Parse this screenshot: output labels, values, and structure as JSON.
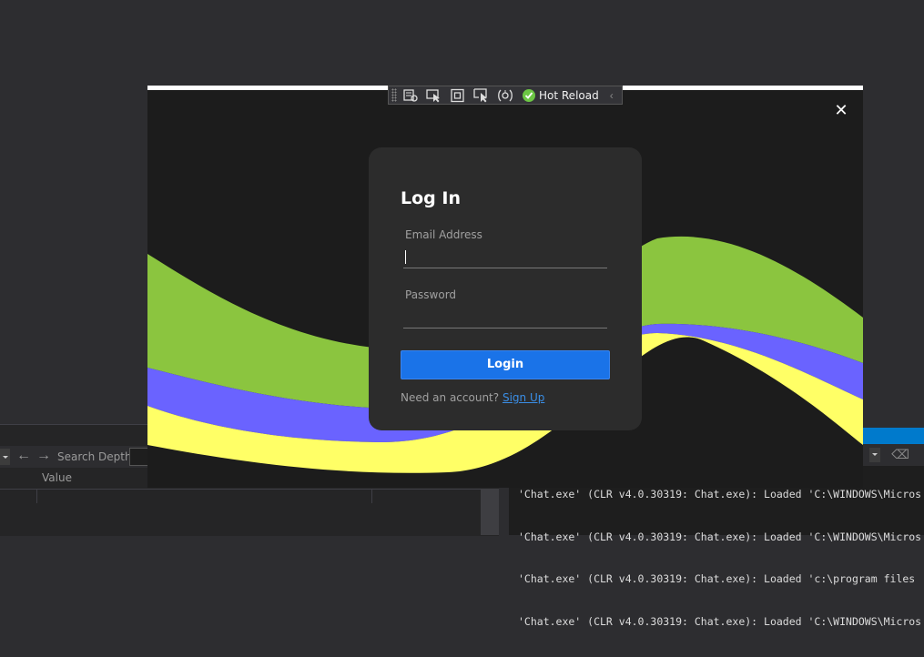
{
  "ide": {
    "locals_toolbar": {
      "search_depth_label": "Search Depth:"
    },
    "locals_header": {
      "value_col": "Value"
    },
    "output_lines": [
      "'Chat.exe' (CLR v4.0.30319: Chat.exe): Loaded 'C:\\WINDOWS\\Micros",
      "'Chat.exe' (CLR v4.0.30319: Chat.exe): Loaded 'C:\\WINDOWS\\Micros",
      "'Chat.exe' (CLR v4.0.30319: Chat.exe): Loaded 'c:\\program files",
      "'Chat.exe' (CLR v4.0.30319: Chat.exe): Loaded 'C:\\WINDOWS\\Micros"
    ]
  },
  "hot_toolbar": {
    "hot_reload_label": "Hot Reload"
  },
  "app": {
    "close_glyph": "✕",
    "login": {
      "title": "Log In",
      "email_label": "Email Address",
      "email_value": "",
      "password_label": "Password",
      "password_value": "",
      "login_button": "Login",
      "signup_prompt": "Need an account?",
      "signup_link": "Sign Up"
    },
    "colors": {
      "wave_green": "#8bc53f",
      "wave_yellow": "#ffff66",
      "wave_purple": "#6a63ff",
      "button_blue": "#1a73e8",
      "link_blue": "#3a8ee6"
    }
  }
}
